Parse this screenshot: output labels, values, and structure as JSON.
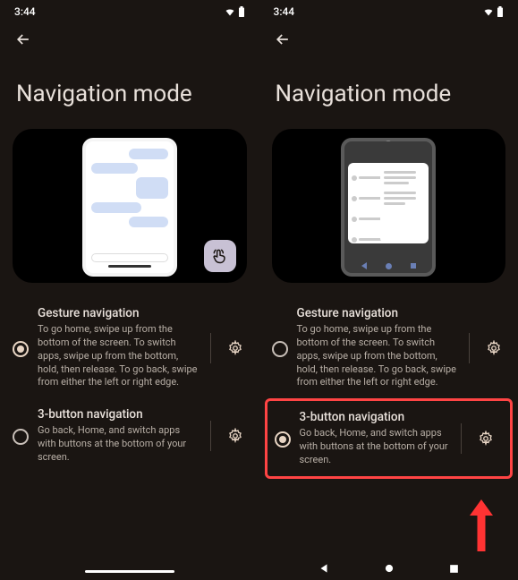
{
  "status": {
    "time": "3:44"
  },
  "title": "Navigation mode",
  "options": {
    "gesture": {
      "title": "Gesture navigation",
      "desc": "To go home, swipe up from the bottom of the screen. To switch apps, swipe up from the bottom, hold, then release. To go back, swipe from either the left or right edge."
    },
    "threebtn": {
      "title": "3-button navigation",
      "desc": "Go back, Home, and switch apps with buttons at the bottom of your screen."
    }
  }
}
